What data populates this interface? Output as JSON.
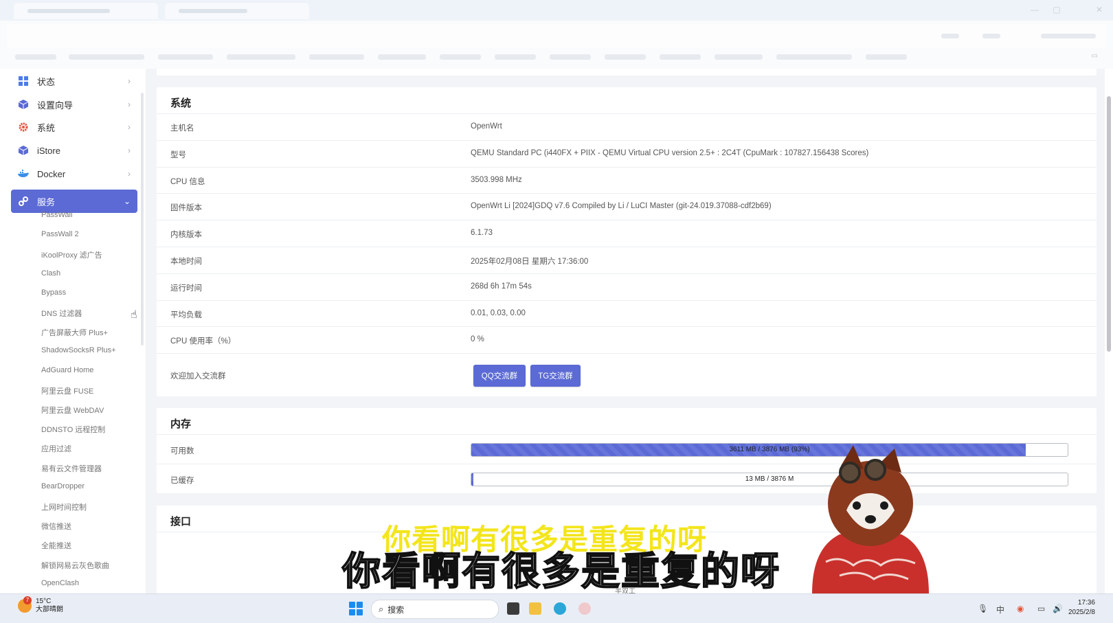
{
  "sidebar": {
    "menu": [
      {
        "label": "状态",
        "icon": "dashboard-icon"
      },
      {
        "label": "设置向导",
        "icon": "cube-icon"
      },
      {
        "label": "系统",
        "icon": "gear-icon"
      },
      {
        "label": "iStore",
        "icon": "cube-icon"
      },
      {
        "label": "Docker",
        "icon": "docker-icon"
      },
      {
        "label": "服务",
        "icon": "link-icon",
        "active": true
      }
    ],
    "services": [
      "PassWall",
      "PassWall 2",
      "iKoolProxy 滤广告",
      "Clash",
      "Bypass",
      "DNS 过滤器",
      "广告屏蔽大师 Plus+",
      "ShadowSocksR Plus+",
      "AdGuard Home",
      "阿里云盘 FUSE",
      "阿里云盘 WebDAV",
      "DDNSTO 远程控制",
      "应用过滤",
      "易有云文件管理器",
      "BearDropper",
      "上网时间控制",
      "微信推送",
      "全能推送",
      "解锁网易云灰色歌曲",
      "OpenClash"
    ]
  },
  "system": {
    "title": "系统",
    "rows": [
      {
        "label": "主机名",
        "value": "OpenWrt"
      },
      {
        "label": "型号",
        "value": "QEMU Standard PC (i440FX + PIIX - QEMU Virtual CPU version 2.5+ : 2C4T (CpuMark : 107827.156438 Scores)"
      },
      {
        "label": "CPU 信息",
        "value": "3503.998 MHz"
      },
      {
        "label": "固件版本",
        "value": "OpenWrt Li [2024]GDQ v7.6 Compiled by Li / LuCI Master (git-24.019.37088-cdf2b69)"
      },
      {
        "label": "内核版本",
        "value": "6.1.73"
      },
      {
        "label": "本地时间",
        "value": "2025年02月08日 星期六 17:36:00"
      },
      {
        "label": "运行时间",
        "value": "268d 6h 17m 54s"
      },
      {
        "label": "平均负载",
        "value": "0.01, 0.03, 0.00"
      },
      {
        "label": "CPU 使用率（%）",
        "value": "0 %"
      }
    ],
    "community_label": "欢迎加入交流群",
    "qq_button": "QQ交流群",
    "tg_button": "TG交流群"
  },
  "memory": {
    "title": "内存",
    "available_label": "可用数",
    "available_text": "3611 MB / 3876 MB (93%)",
    "available_fraction": 0.93,
    "cached_label": "已缓存",
    "cached_text": "13 MB / 3876 M",
    "cached_fraction": 0.003
  },
  "interfaces": {
    "title": "接口"
  },
  "overlay": {
    "subtitle_back": "你看啊有很多是重复的呀",
    "subtitle": "你看啊有很多是重复的呀",
    "small_text": "半双工"
  },
  "taskbar": {
    "weather_temp": "15°C",
    "weather_desc": "大部晴朗",
    "weather_badge": "7",
    "search_label": "搜索",
    "time": "17:36",
    "date": "2025/2/8"
  },
  "colors": {
    "accent": "#5b6ad4",
    "subtitle_yellow": "#f3e51c"
  }
}
